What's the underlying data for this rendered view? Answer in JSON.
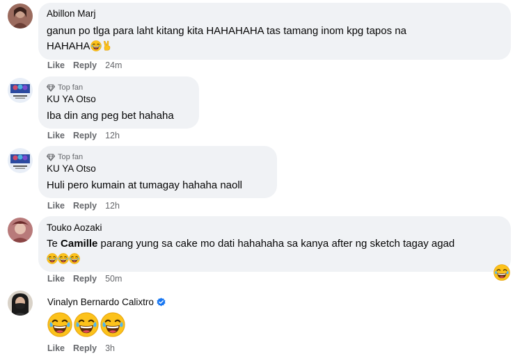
{
  "actions": {
    "like": "Like",
    "reply": "Reply"
  },
  "comments": [
    {
      "author": "Abillon Marj",
      "text_line1": "ganun po tlga para laht kitang kita HAHAHAHA tas tamang inom kpg tapos na",
      "text_line2": "HAHAHA",
      "time": "24m"
    },
    {
      "badge": "Top fan",
      "author": "KU YA Otso",
      "text": "Iba din ang peg bet hahaha",
      "time": "12h"
    },
    {
      "badge": "Top fan",
      "author": "KU YA Otso",
      "text": "Huli pero kumain at tumagay hahaha naoll",
      "time": "12h"
    },
    {
      "author": "Touko Aozaki",
      "text_prefix": "Te ",
      "mention": "Camille",
      "text_rest": " parang yung sa cake mo dati hahahaha sa kanya after ng sketch tagay agad",
      "time": "50m"
    },
    {
      "author": "Vinalyn Bernardo Calixtro",
      "time": "3h"
    }
  ],
  "colors": {
    "bubble": "#f0f2f5",
    "meta_text": "#65676b",
    "text": "#050505",
    "verified": "#1877f2",
    "emoji_yellow": "#fcc21b"
  }
}
